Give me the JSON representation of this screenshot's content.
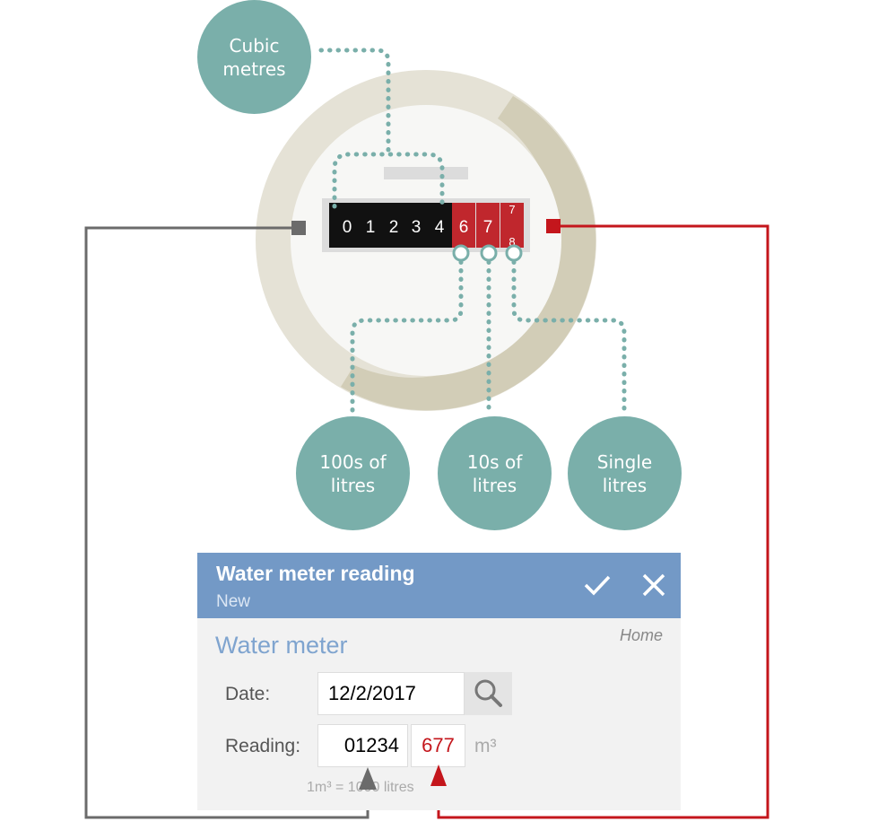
{
  "bubbles": {
    "cubic": "Cubic\nmetres",
    "hundreds": "100s of\nlitres",
    "tens": "10s of\nlitres",
    "singles": "Single\nlitres"
  },
  "meter": {
    "black_digits": [
      "0",
      "1",
      "2",
      "3",
      "4"
    ],
    "red_digits": [
      "6",
      "7"
    ],
    "last_wheel_top": "7",
    "last_wheel_bottom": "8"
  },
  "dialog": {
    "title": "Water meter reading",
    "subtitle": "New",
    "section_title": "Water meter",
    "section_tag": "Home",
    "date_label": "Date:",
    "date_value": "12/2/2017",
    "reading_label": "Reading:",
    "reading_m3": "01234",
    "reading_litres": "677",
    "unit": "m³",
    "hint": "1m³ = 1000 litres"
  },
  "colors": {
    "bubble": "#7aafaa",
    "header": "#7399c6",
    "accent_red": "#c4161c",
    "connector_gray": "#6b6b6b"
  },
  "icons": [
    "check-icon",
    "close-icon",
    "search-icon"
  ]
}
